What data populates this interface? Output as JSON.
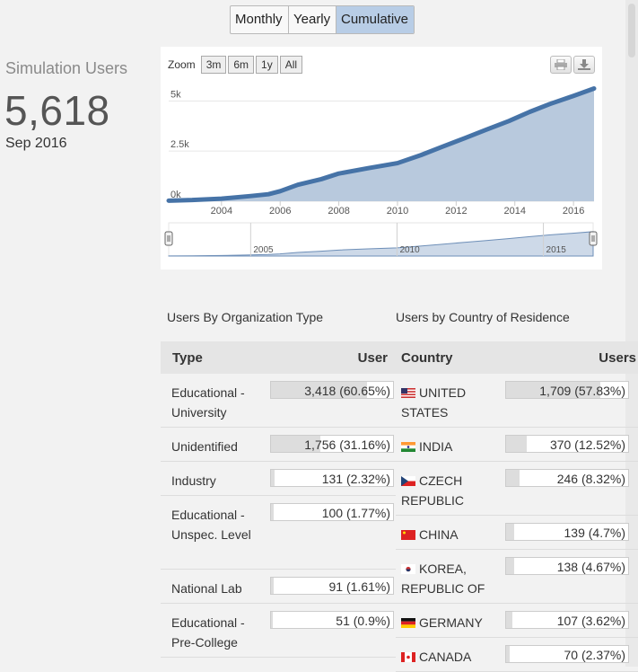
{
  "view_toggle": {
    "monthly": "Monthly",
    "yearly": "Yearly",
    "cumulative": "Cumulative",
    "active": "Cumulative"
  },
  "stat": {
    "label": "Simulation Users",
    "value": "5,618",
    "date": "Sep 2016"
  },
  "chart": {
    "zoom_label": "Zoom",
    "zoom_buttons": [
      "3m",
      "6m",
      "1y",
      "All"
    ],
    "print_icon": "printer-icon",
    "download_icon": "download-icon",
    "fill_color": "#b8c9dd",
    "line_color": "#4673a7"
  },
  "chart_data": {
    "type": "area",
    "y_ticks": [
      "0k",
      "2.5k",
      "5k"
    ],
    "x_ticks": [
      "2004",
      "2006",
      "2008",
      "2010",
      "2012",
      "2014",
      "2016"
    ],
    "navigator_ticks": [
      "2005",
      "2010",
      "2015"
    ],
    "ylim": [
      0,
      6000
    ],
    "xlim": [
      2002.2,
      2016.7
    ],
    "points": [
      [
        2002.2,
        30
      ],
      [
        2003.0,
        60
      ],
      [
        2004.0,
        130
      ],
      [
        2005.0,
        260
      ],
      [
        2005.6,
        350
      ],
      [
        2006.0,
        500
      ],
      [
        2006.6,
        820
      ],
      [
        2007.4,
        1100
      ],
      [
        2008.0,
        1380
      ],
      [
        2009.0,
        1650
      ],
      [
        2010.0,
        1900
      ],
      [
        2010.8,
        2300
      ],
      [
        2011.5,
        2700
      ],
      [
        2012.3,
        3150
      ],
      [
        2013.0,
        3550
      ],
      [
        2013.8,
        4000
      ],
      [
        2014.5,
        4450
      ],
      [
        2015.2,
        4850
      ],
      [
        2016.0,
        5250
      ],
      [
        2016.7,
        5618
      ]
    ]
  },
  "org_table": {
    "title": "Users By Organization Type",
    "headers": {
      "type": "Type",
      "user": "User"
    },
    "rows": [
      {
        "type": "Educational - University",
        "value": "3,418 (60.65%)",
        "pct": 60.65
      },
      {
        "type": "Unidentified",
        "value": "1,756 (31.16%)",
        "pct": 31.16
      },
      {
        "type": "Industry",
        "value": "131 (2.32%)",
        "pct": 2.32
      },
      {
        "type": "Educational - Unspec. Level",
        "value": "100 (1.77%)",
        "pct": 1.77
      },
      {
        "type": "National Lab",
        "value": "91 (1.61%)",
        "pct": 1.61
      },
      {
        "type": "Educational - Pre-College",
        "value": "51 (0.9%)",
        "pct": 0.9
      }
    ]
  },
  "country_table": {
    "title": "Users by Country of Residence",
    "headers": {
      "country": "Country",
      "users": "Users"
    },
    "rows": [
      {
        "country": "UNITED STATES",
        "flag": "us-flag-icon",
        "value": "1,709 (57.83%)",
        "pct": 57.83
      },
      {
        "country": "INDIA",
        "flag": "india-flag-icon",
        "value": "370 (12.52%)",
        "pct": 12.52
      },
      {
        "country": "CZECH REPUBLIC",
        "flag": "czech-flag-icon",
        "value": "246 (8.32%)",
        "pct": 8.32
      },
      {
        "country": "CHINA",
        "flag": "china-flag-icon",
        "value": "139 (4.7%)",
        "pct": 4.7
      },
      {
        "country": "KOREA, REPUBLIC OF",
        "flag": "korea-flag-icon",
        "value": "138 (4.67%)",
        "pct": 4.67
      },
      {
        "country": "GERMANY",
        "flag": "germany-flag-icon",
        "value": "107 (3.62%)",
        "pct": 3.62
      },
      {
        "country": "CANADA",
        "flag": "canada-flag-icon",
        "value": "70 (2.37%)",
        "pct": 2.37
      }
    ]
  }
}
